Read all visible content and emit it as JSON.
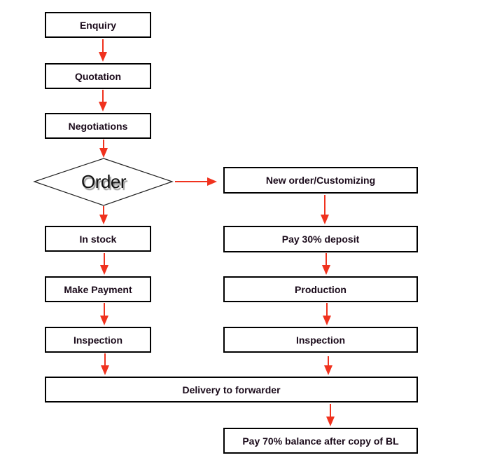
{
  "diagram": {
    "decision": {
      "label": "Order"
    },
    "left_branch": [
      {
        "id": "enquiry",
        "label": "Enquiry"
      },
      {
        "id": "quotation",
        "label": "Quotation"
      },
      {
        "id": "negotiations",
        "label": "Negotiations"
      },
      {
        "id": "in-stock",
        "label": "In stock"
      },
      {
        "id": "make-payment",
        "label": "Make Payment"
      },
      {
        "id": "inspection-left",
        "label": "Inspection"
      }
    ],
    "right_branch": [
      {
        "id": "new-order",
        "label": "New order/Customizing"
      },
      {
        "id": "deposit",
        "label": "Pay 30% deposit"
      },
      {
        "id": "production",
        "label": "Production"
      },
      {
        "id": "inspection-right",
        "label": "Inspection"
      }
    ],
    "delivery": {
      "label": "Delivery to forwarder"
    },
    "final": {
      "label": "Pay 70% balance after copy of BL"
    },
    "edges": [
      [
        "enquiry",
        "quotation"
      ],
      [
        "quotation",
        "negotiations"
      ],
      [
        "negotiations",
        "order"
      ],
      [
        "order",
        "in-stock"
      ],
      [
        "order",
        "new-order"
      ],
      [
        "in-stock",
        "make-payment"
      ],
      [
        "make-payment",
        "inspection-left"
      ],
      [
        "new-order",
        "deposit"
      ],
      [
        "deposit",
        "production"
      ],
      [
        "production",
        "inspection-right"
      ],
      [
        "inspection-left",
        "delivery"
      ],
      [
        "inspection-right",
        "delivery"
      ],
      [
        "delivery",
        "final"
      ]
    ],
    "colors": {
      "arrow": "#f0321e",
      "box_border": "#000000",
      "text": "#1a0a1a"
    }
  }
}
